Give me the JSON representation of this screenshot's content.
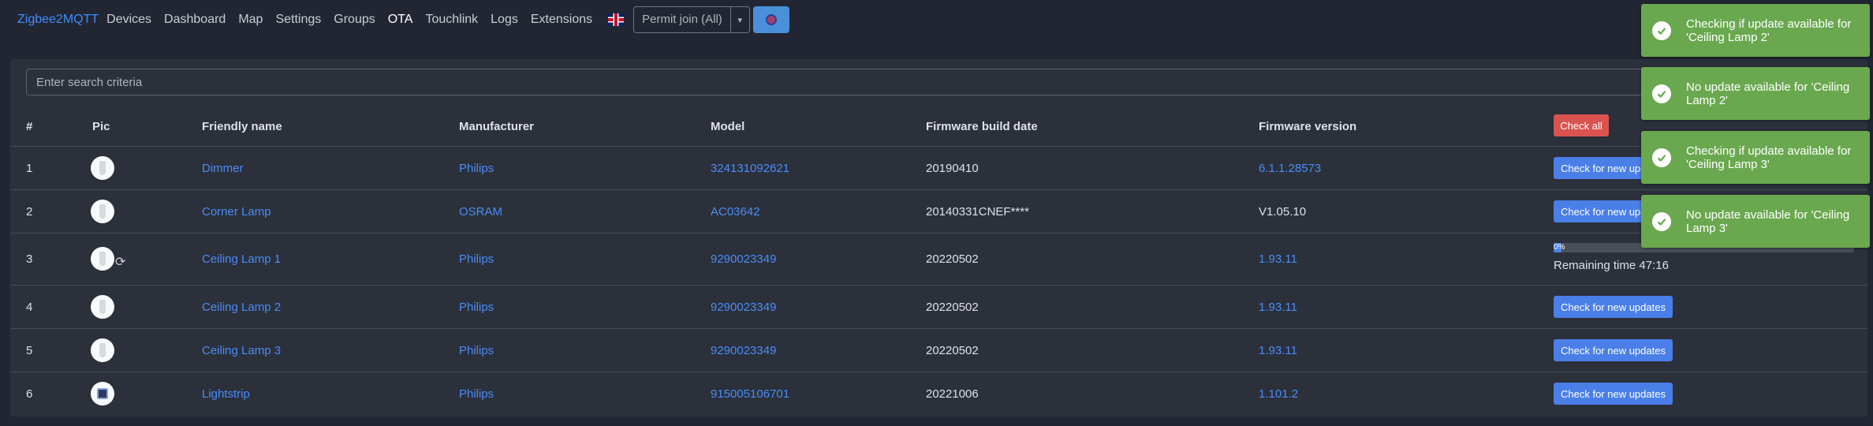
{
  "nav": {
    "brand": "Zigbee2MQTT",
    "items": [
      "Devices",
      "Dashboard",
      "Map",
      "Settings",
      "Groups",
      "OTA",
      "Touchlink",
      "Logs",
      "Extensions"
    ],
    "active": "OTA",
    "language_icon": "uk-flag-icon",
    "permit_join_label": "Permit join (All)"
  },
  "search": {
    "placeholder": "Enter search criteria",
    "value": ""
  },
  "table": {
    "headers": {
      "num": "#",
      "pic": "Pic",
      "friendly_name": "Friendly name",
      "manufacturer": "Manufacturer",
      "model": "Model",
      "build_date": "Firmware build date",
      "version": "Firmware version"
    },
    "check_all_label": "Check all",
    "rows": [
      {
        "num": "1",
        "name": "Dimmer",
        "manufacturer": "Philips",
        "model": "324131092621",
        "build_date": "20190410",
        "version": "6.1.1.28573",
        "version_link": true,
        "action": "Check for new updates"
      },
      {
        "num": "2",
        "name": "Corner Lamp",
        "manufacturer": "OSRAM",
        "model": "AC03642",
        "build_date": "20140331CNEF****",
        "version": "V1.05.10",
        "version_link": false,
        "action": "Check for new updates"
      },
      {
        "num": "3",
        "name": "Ceiling Lamp 1",
        "manufacturer": "Philips",
        "model": "9290023349",
        "build_date": "20220502",
        "version": "1.93.11",
        "version_link": true,
        "updating": true,
        "progress_label": "0%",
        "progress": 0.0,
        "remaining": "Remaining time 47:16"
      },
      {
        "num": "4",
        "name": "Ceiling Lamp 2",
        "manufacturer": "Philips",
        "model": "9290023349",
        "build_date": "20220502",
        "version": "1.93.11",
        "version_link": true,
        "action": "Check for new updates"
      },
      {
        "num": "5",
        "name": "Ceiling Lamp 3",
        "manufacturer": "Philips",
        "model": "9290023349",
        "build_date": "20220502",
        "version": "1.93.11",
        "version_link": true,
        "action": "Check for new updates"
      },
      {
        "num": "6",
        "name": "Lightstrip",
        "manufacturer": "Philips",
        "model": "915005106701",
        "build_date": "20221006",
        "version": "1.101.2",
        "version_link": true,
        "action": "Check for new updates"
      }
    ]
  },
  "toasts": [
    "Checking if update available for 'Ceiling Lamp 2'",
    "No update available for 'Ceiling Lamp 2'",
    "Checking if update available for 'Ceiling Lamp 3'",
    "No update available for 'Ceiling Lamp 3'"
  ],
  "colors": {
    "background": "#222632",
    "card": "#2b303b",
    "link": "#4a8cf7",
    "primary_button": "#4a7fe8",
    "danger_button": "#d9534f",
    "toast_success": "#6aa84f"
  }
}
